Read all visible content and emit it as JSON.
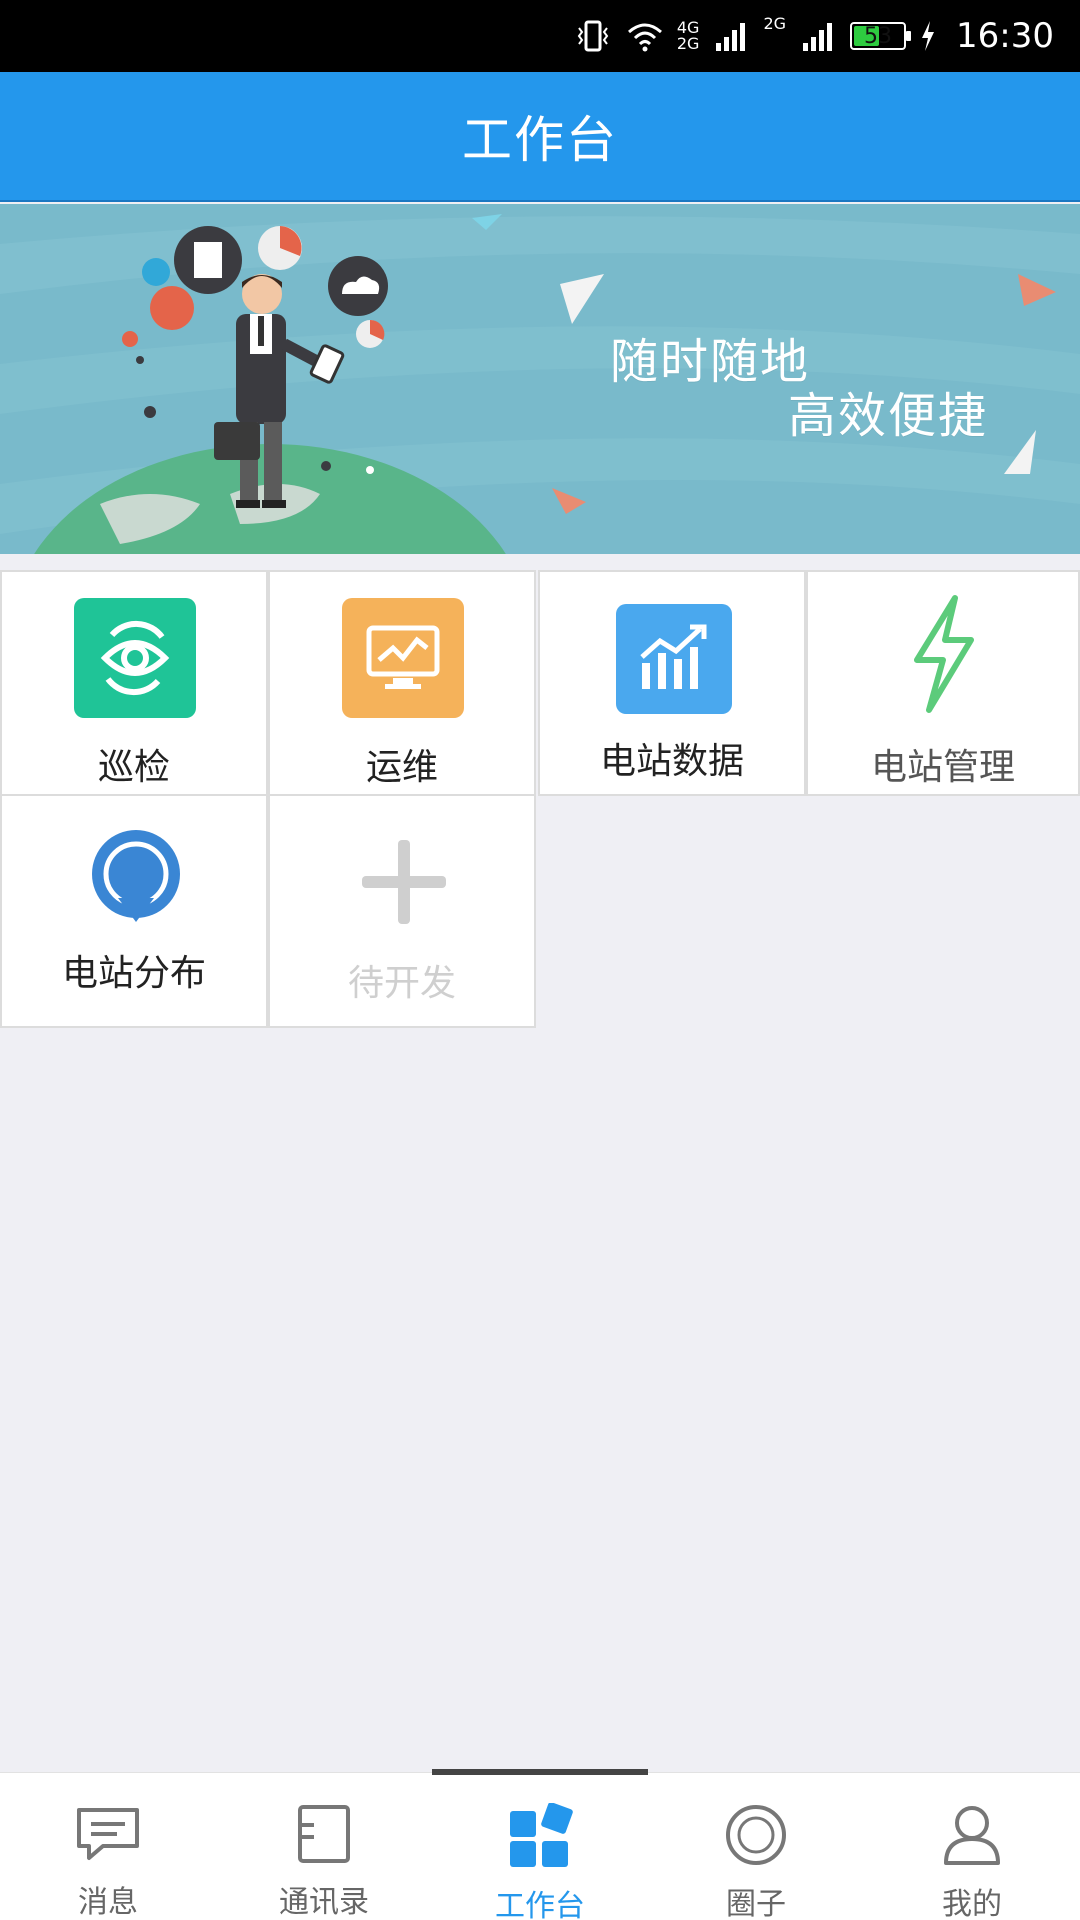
{
  "status_bar": {
    "network_top": "4G",
    "network_bottom": "2G",
    "network2": "2G",
    "battery": "53",
    "battery_level": 0.53,
    "time": "16:30"
  },
  "header": {
    "title": "工作台"
  },
  "banner": {
    "line1": "随时随地",
    "line2": "高效便捷"
  },
  "grid": {
    "items": [
      {
        "label": "巡检",
        "icon": "eye-rotate-icon",
        "color": "#1fc497"
      },
      {
        "label": "运维",
        "icon": "monitor-chart-icon",
        "color": "#f5b25a"
      },
      {
        "label": "电站数据",
        "icon": "bar-chart-icon",
        "color": "#4aa8ee"
      },
      {
        "label": "电站管理",
        "icon": "lightning-icon",
        "color": "#5ccb7b"
      },
      {
        "label": "电站分布",
        "icon": "ring-icon",
        "color": "#3a86d4"
      },
      {
        "label": "待开发",
        "icon": "plus-icon",
        "color": "#cfcfcf"
      }
    ]
  },
  "tabbar": {
    "tabs": [
      {
        "label": "消息",
        "icon": "chat-bubble-icon"
      },
      {
        "label": "通讯录",
        "icon": "contacts-book-icon"
      },
      {
        "label": "工作台",
        "icon": "workbench-icon",
        "active": true
      },
      {
        "label": "圈子",
        "icon": "circle-icon"
      },
      {
        "label": "我的",
        "icon": "person-icon"
      }
    ],
    "active_color": "#2497ec"
  }
}
